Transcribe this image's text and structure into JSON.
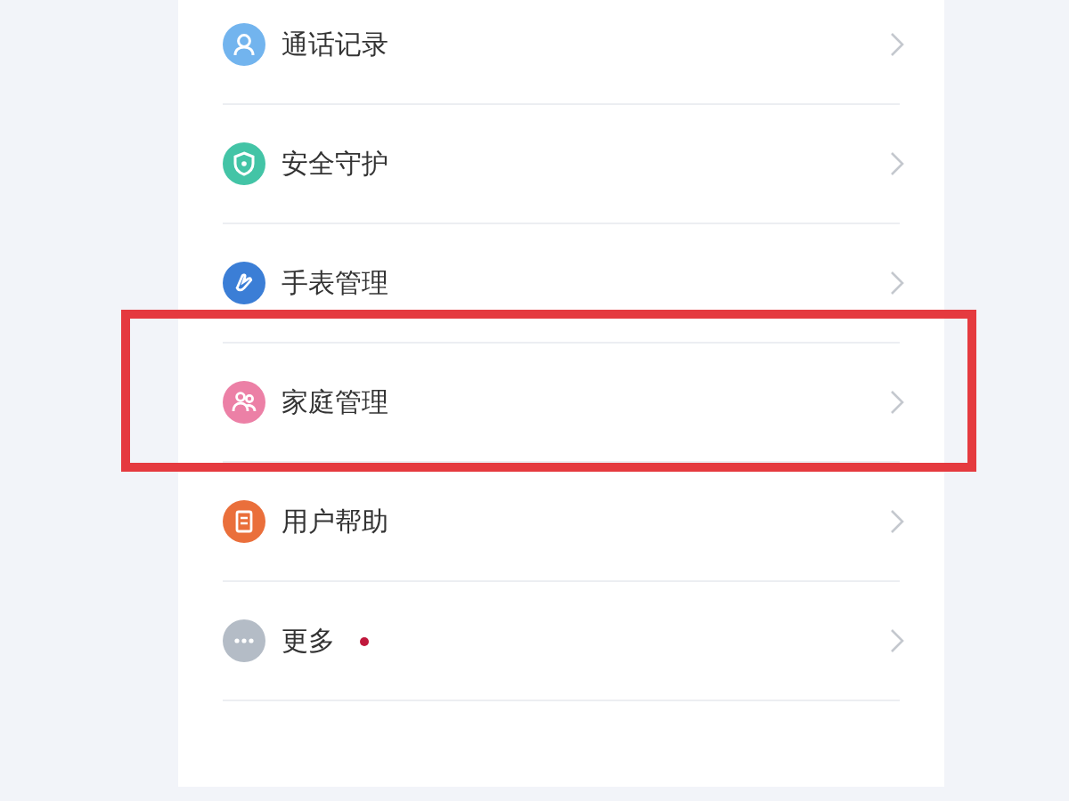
{
  "menu": [
    {
      "label": "通话记录",
      "kind": "person",
      "highlighted": false,
      "dot": false
    },
    {
      "label": "安全守护",
      "kind": "shield",
      "highlighted": false,
      "dot": false
    },
    {
      "label": "手表管理",
      "kind": "hand",
      "highlighted": false,
      "dot": false
    },
    {
      "label": "家庭管理",
      "kind": "family",
      "highlighted": true,
      "dot": false
    },
    {
      "label": "用户帮助",
      "kind": "document",
      "highlighted": false,
      "dot": false
    },
    {
      "label": "更多",
      "kind": "dots",
      "highlighted": false,
      "dot": true
    }
  ]
}
